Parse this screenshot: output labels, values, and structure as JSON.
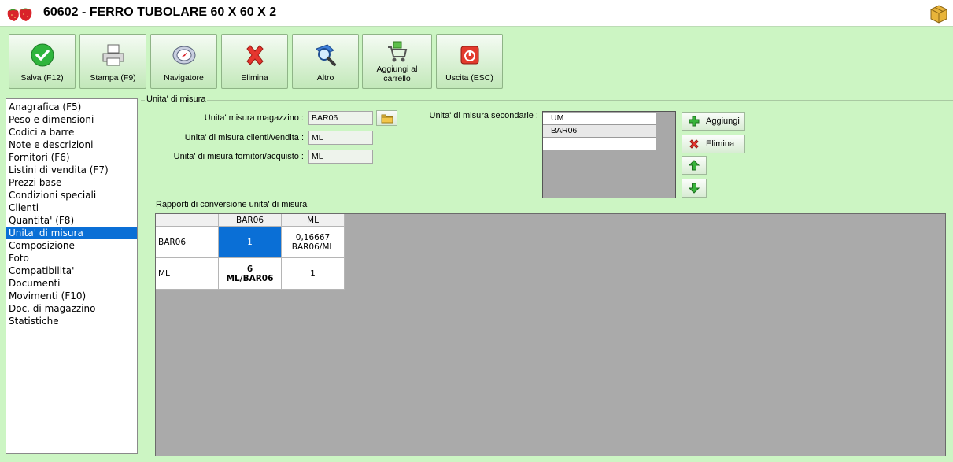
{
  "window": {
    "title": "60602 - FERRO TUBOLARE 60 X 60 X 2"
  },
  "toolbar": {
    "save": "Salva (F12)",
    "print": "Stampa (F9)",
    "navigator": "Navigatore",
    "delete": "Elimina",
    "other": "Altro",
    "cart_line1": "Aggiungi al",
    "cart_line2": "carrello",
    "exit": "Uscita (ESC)"
  },
  "nav": {
    "items": [
      "Anagrafica (F5)",
      "Peso e dimensioni",
      "Codici a barre",
      "Note e descrizioni",
      "Fornitori (F6)",
      "Listini di vendita (F7)",
      "Prezzi base",
      "Condizioni speciali",
      "Clienti",
      "Quantita' (F8)",
      "Unita' di misura",
      "Composizione",
      "Foto",
      "Compatibilita'",
      "Documenti",
      "Movimenti (F10)",
      "Doc. di magazzino",
      "Statistiche"
    ],
    "active": "Unita' di misura"
  },
  "section": {
    "title": "Unita' di misura",
    "warehouse_label": "Unita' misura magazzino :",
    "warehouse_value": "BAR06",
    "customer_label": "Unita' di misura clienti/vendita :",
    "customer_value": "ML",
    "supplier_label": "Unita' di misura fornitori/acquisto :",
    "supplier_value": "ML",
    "secondary_label": "Unita' di misura secondarie :",
    "secondary_header": "UM",
    "secondary_rows": [
      "BAR06",
      ""
    ],
    "add_button": "Aggiungi",
    "delete_button": "Elimina"
  },
  "conversion": {
    "title": "Rapporti di conversione unita' di misura",
    "columns": [
      "BAR06",
      "ML"
    ],
    "rows": [
      {
        "label": "BAR06",
        "cells": [
          [
            "1"
          ],
          [
            "0,16667",
            "BAR06/ML"
          ]
        ]
      },
      {
        "label": "ML",
        "cells": [
          [
            "6",
            "ML/BAR06"
          ],
          [
            "1"
          ]
        ]
      }
    ]
  },
  "colors": {
    "background": "#ccf5c3",
    "selection": "#0a6fd6"
  }
}
